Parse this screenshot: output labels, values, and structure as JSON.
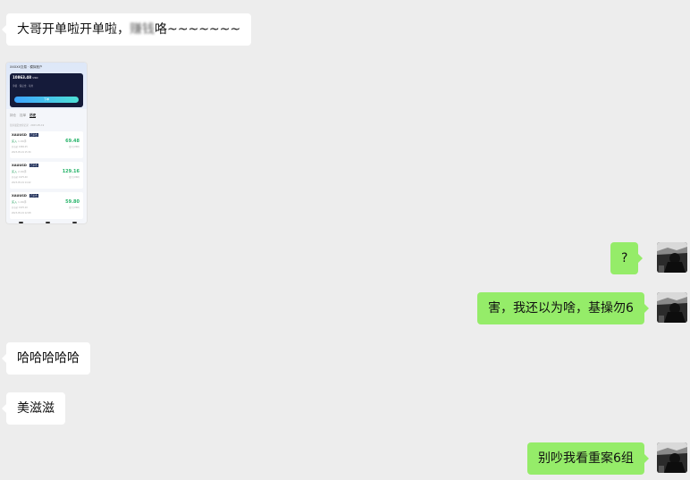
{
  "messages": [
    {
      "side": "left",
      "text_before": "大哥开单啦开单啦，",
      "blurred": "赚钱",
      "text_after": "咯~~~~~~~"
    },
    {
      "side": "right",
      "text": "?"
    },
    {
      "side": "right",
      "text": "害，我还以为啥，基操勿6"
    },
    {
      "side": "left",
      "text": "哈哈哈哈哈"
    },
    {
      "side": "left",
      "text": "美滋滋"
    },
    {
      "side": "right",
      "text": "别吵我看重案6组"
    }
  ],
  "thumbnail": {
    "header_title": "XXXXX交易 · 模拟账户",
    "balance": "10863.48",
    "balance_unit": "USD",
    "card_right": "净值 · 保证金 · 可用",
    "button": "下单",
    "tabs": [
      "持仓",
      "挂单",
      "历史"
    ],
    "active_tab": "历史",
    "note": "显示最近交易记录 · 2023-05-19",
    "orders": [
      {
        "symbol": "XAUUSD",
        "tag": "已平仓",
        "side": "买入",
        "size": "1.00手",
        "sub1": "开仓价 1982.25",
        "sub2": "2023-05-19 15:30",
        "pnl": "69.48",
        "pnl_label": "盈亏(USD)"
      },
      {
        "symbol": "XAUUSD",
        "tag": "已平仓",
        "side": "买入",
        "size": "2.00手",
        "sub1": "开仓价 1975.40",
        "sub2": "2023-05-19 14:22",
        "pnl": "129.16",
        "pnl_label": "盈亏(USD)"
      },
      {
        "symbol": "XAUUSD",
        "tag": "已平仓",
        "side": "买入",
        "size": "1.00手",
        "sub1": "开仓价 1970.10",
        "sub2": "2023-05-19 12:08",
        "pnl": "59.80",
        "pnl_label": "盈亏(USD)"
      }
    ]
  },
  "colors": {
    "chat_bg": "#ededed",
    "left_bubble": "#ffffff",
    "right_bubble": "#95ec69",
    "profit": "#28b46a"
  },
  "icons": {
    "avatar": "user-avatar-icon"
  }
}
